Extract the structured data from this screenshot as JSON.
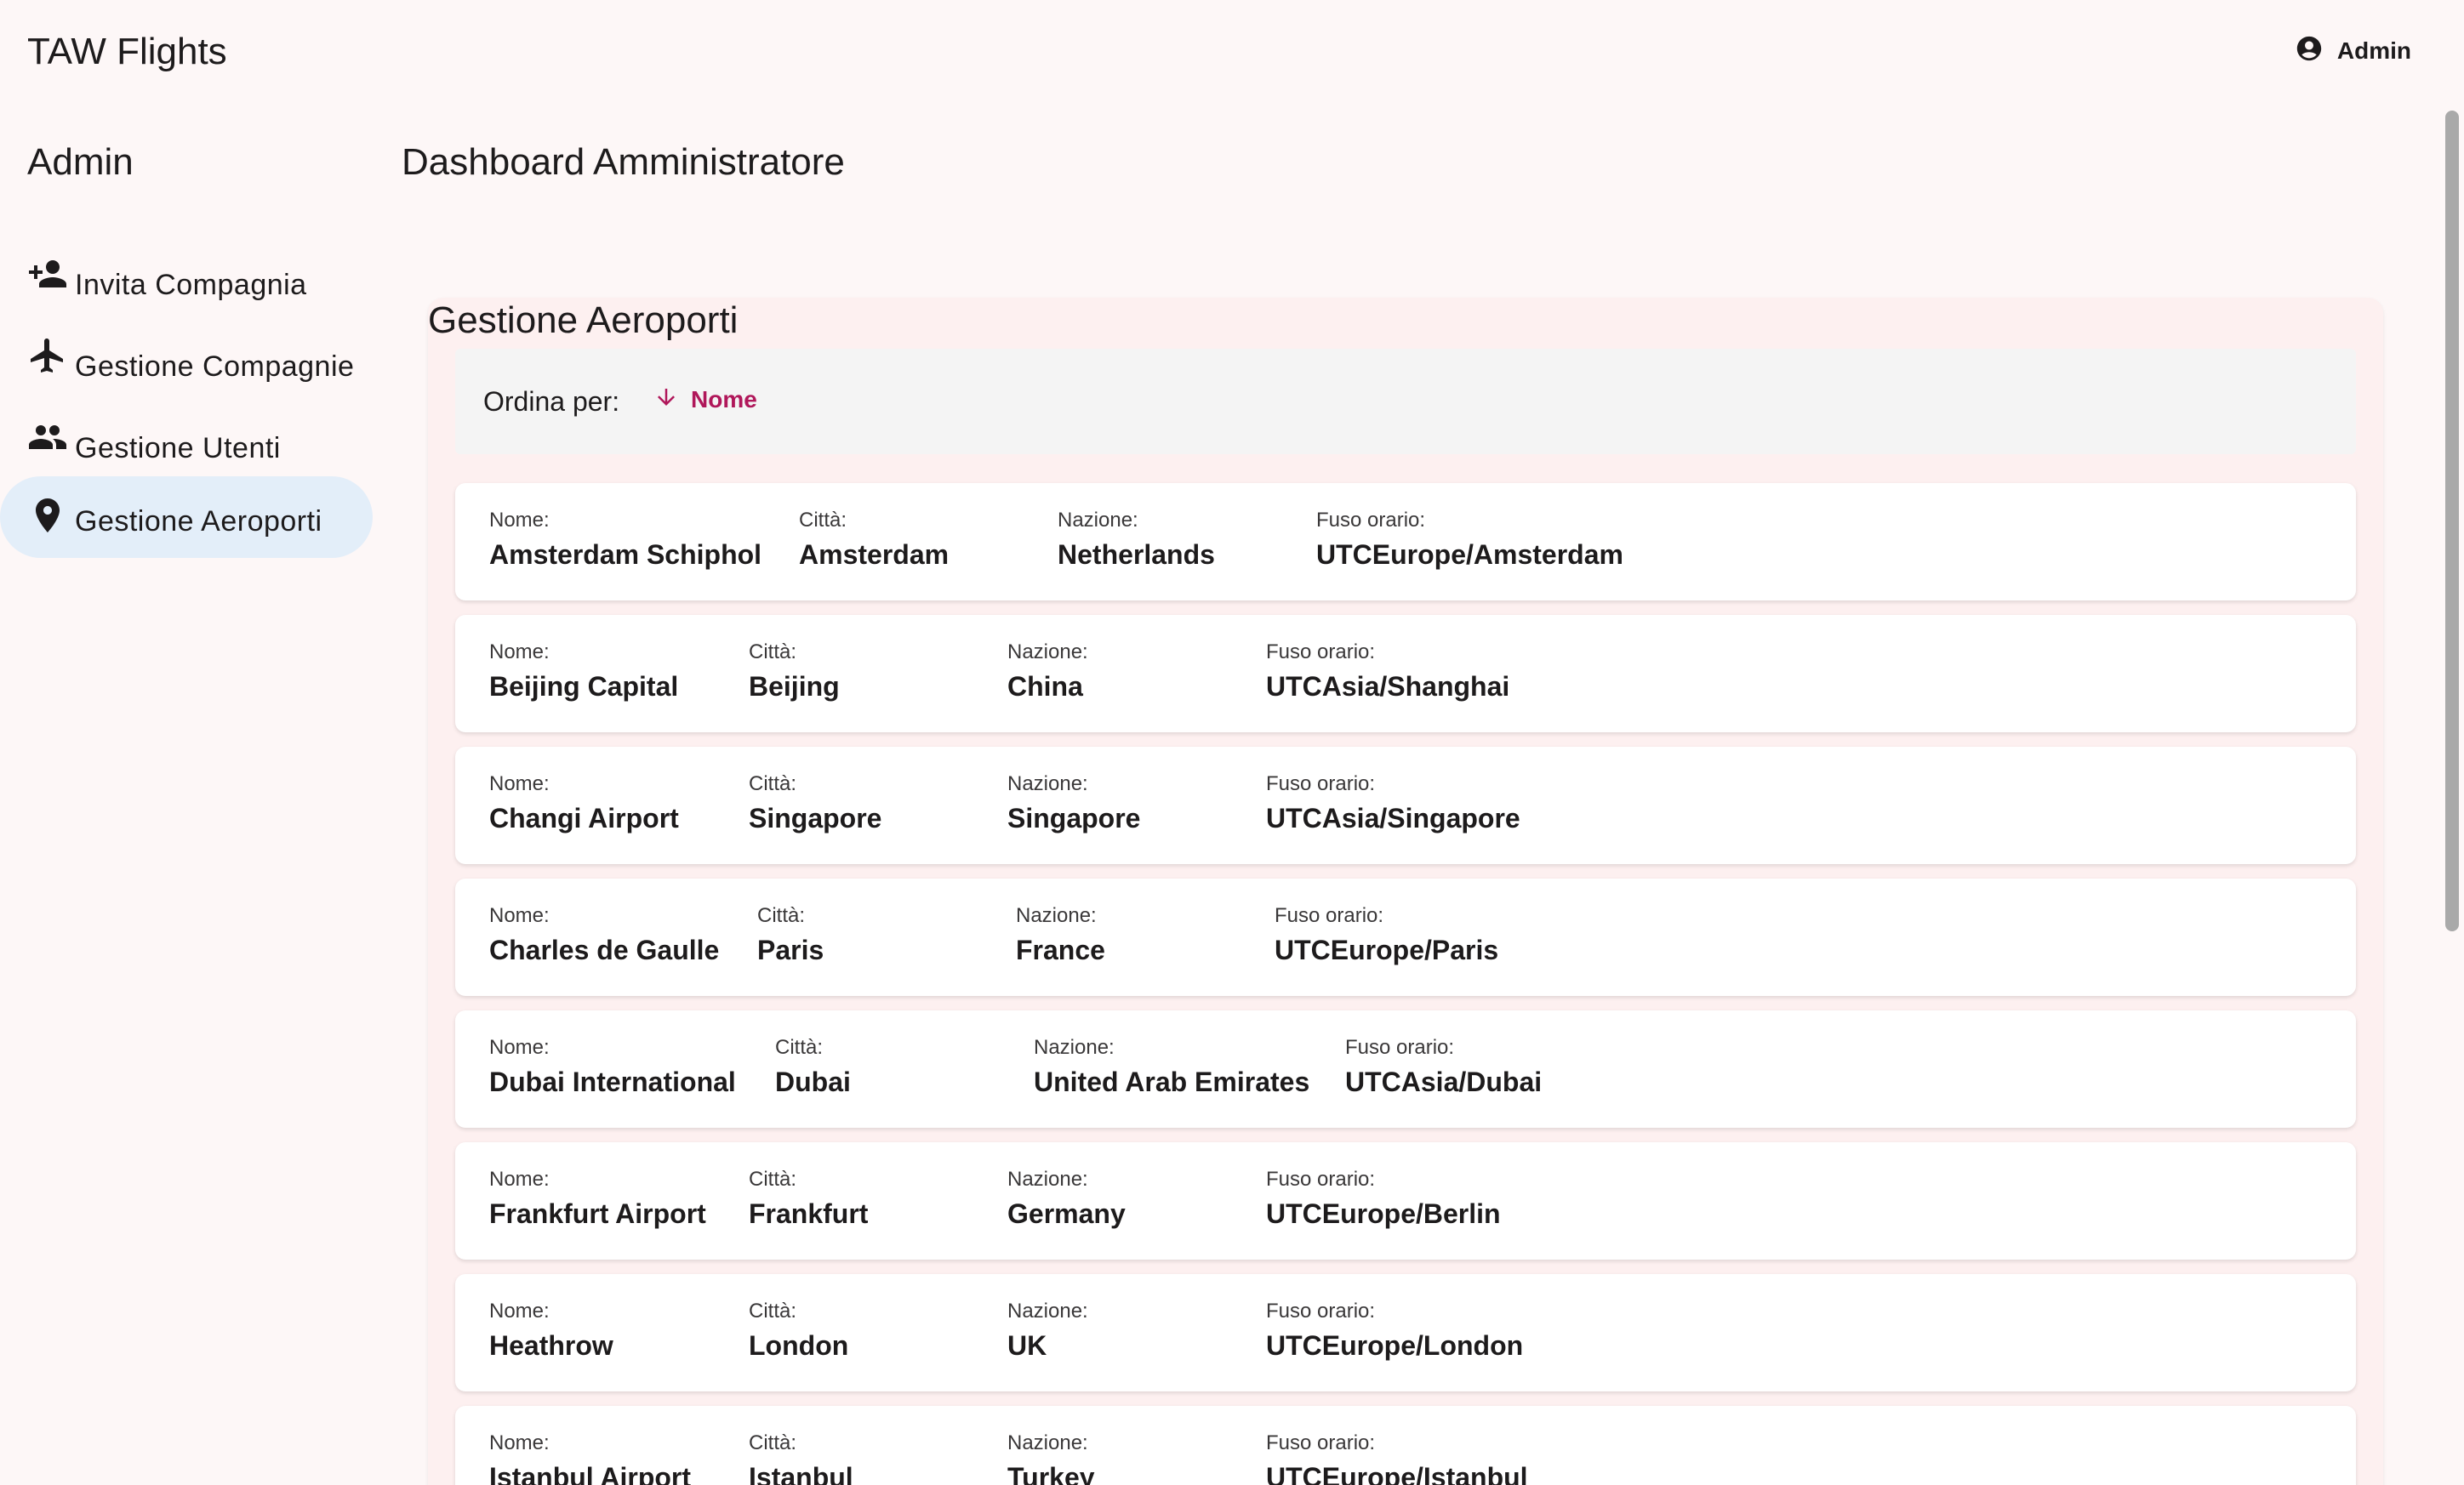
{
  "app": {
    "title": "TAW Flights"
  },
  "user": {
    "label": "Admin",
    "icon": "account-circle-icon"
  },
  "sidebar": {
    "heading": "Admin",
    "items": [
      {
        "label": "Invita Compagnia",
        "icon": "person-add-icon",
        "active": false
      },
      {
        "label": "Gestione Compagnie",
        "icon": "airplane-icon",
        "active": false
      },
      {
        "label": "Gestione Utenti",
        "icon": "people-icon",
        "active": false
      },
      {
        "label": "Gestione Aeroporti",
        "icon": "location-pin-icon",
        "active": true
      }
    ]
  },
  "main": {
    "title": "Dashboard Amministratore",
    "section_title": "Gestione Aeroporti",
    "sort": {
      "label": "Ordina per:",
      "button_label": "Nome",
      "direction_icon": "arrow-down-icon"
    },
    "field_labels": {
      "name": "Nome:",
      "city": "Città:",
      "country": "Nazione:",
      "timezone": "Fuso orario:"
    },
    "airports": [
      {
        "name": "Amsterdam Schiphol",
        "city": "Amsterdam",
        "country": "Netherlands",
        "timezone": "UTCEurope/Amsterdam"
      },
      {
        "name": "Beijing Capital",
        "city": "Beijing",
        "country": "China",
        "timezone": "UTCAsia/Shanghai"
      },
      {
        "name": "Changi Airport",
        "city": "Singapore",
        "country": "Singapore",
        "timezone": "UTCAsia/Singapore"
      },
      {
        "name": "Charles de Gaulle",
        "city": "Paris",
        "country": "France",
        "timezone": "UTCEurope/Paris"
      },
      {
        "name": "Dubai International",
        "city": "Dubai",
        "country": "United Arab Emirates",
        "timezone": "UTCAsia/Dubai"
      },
      {
        "name": "Frankfurt Airport",
        "city": "Frankfurt",
        "country": "Germany",
        "timezone": "UTCEurope/Berlin"
      },
      {
        "name": "Heathrow",
        "city": "London",
        "country": "UK",
        "timezone": "UTCEurope/London"
      },
      {
        "name": "Istanbul Airport",
        "city": "Istanbul",
        "country": "Turkey",
        "timezone": "UTCEurope/Istanbul"
      }
    ]
  },
  "colors": {
    "background": "#fdf7f7",
    "panel": "#fdf0f0",
    "active_nav": "#e3eef9",
    "accent": "#b0175a"
  }
}
